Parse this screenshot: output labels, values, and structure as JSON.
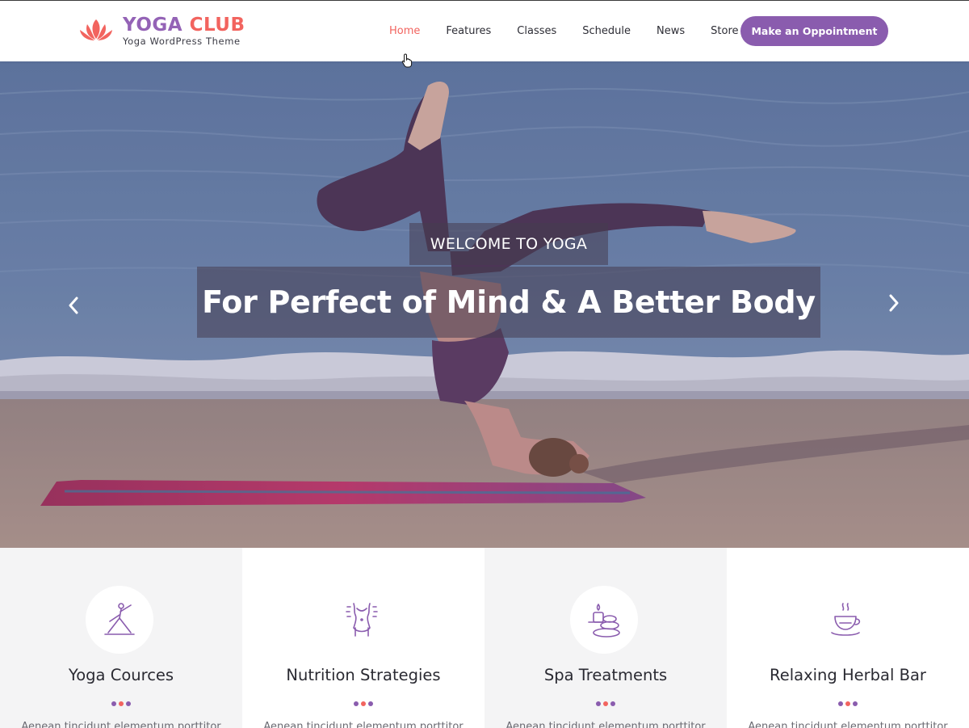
{
  "brand": {
    "name_part1": "YOGA",
    "name_part2": "CLUB",
    "tagline": "Yoga WordPress Theme",
    "logo_icon": "lotus-icon",
    "colors": {
      "purple": "#9463b6",
      "coral": "#f2645f",
      "button": "#8a5cae"
    }
  },
  "nav": {
    "items": [
      {
        "label": "Home",
        "active": true
      },
      {
        "label": "Features",
        "active": false
      },
      {
        "label": "Classes",
        "active": false
      },
      {
        "label": "Schedule",
        "active": false
      },
      {
        "label": "News",
        "active": false
      },
      {
        "label": "Store",
        "active": false
      }
    ],
    "cta_label": "Make an Oppointment"
  },
  "hero": {
    "kicker": "WELCOME TO YOGA",
    "headline": "For Perfect of Mind & A Better Body",
    "prev_icon": "chevron-left-icon",
    "next_icon": "chevron-right-icon"
  },
  "features": [
    {
      "title": "Yoga Cources",
      "icon": "yoga-pose-icon",
      "text": "Aenean tincidunt elementum porttitor"
    },
    {
      "title": "Nutrition Strategies",
      "icon": "body-figure-icon",
      "text": "Aenean tincidunt elementum porttitor"
    },
    {
      "title": "Spa Treatments",
      "icon": "spa-stones-candle-icon",
      "text": "Aenean tincidunt elementum porttitor"
    },
    {
      "title": "Relaxing Herbal Bar",
      "icon": "tea-cup-icon",
      "text": "Aenean tincidunt elementum porttitor"
    }
  ],
  "dot_colors": [
    "#8a5cae",
    "#f2645f",
    "#8a5cae"
  ]
}
